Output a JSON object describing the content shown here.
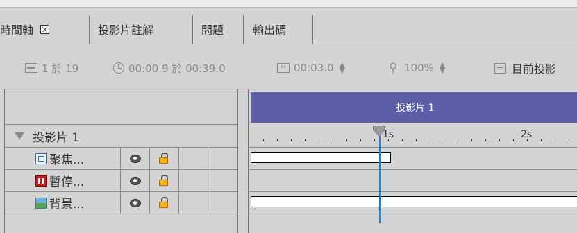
{
  "tabs": [
    {
      "label": "時間軸",
      "active": true
    },
    {
      "label": "投影片註解",
      "active": false
    },
    {
      "label": "問題",
      "active": false
    },
    {
      "label": "輸出碼",
      "active": false
    }
  ],
  "toolbar": {
    "slide_position": "1 於 19",
    "time_position": "00:00.9 於 00:39.0",
    "duration": "00:03.0",
    "zoom": "100%",
    "current_label": "目前投影"
  },
  "layers": {
    "group_name": "投影片 1",
    "items": [
      {
        "name": "聚焦...",
        "icon": "focus-area-icon"
      },
      {
        "name": "暫停...",
        "icon": "pause-icon"
      },
      {
        "name": "背景...",
        "icon": "background-image-icon"
      }
    ]
  },
  "timeline": {
    "slide_header": "投影片 1",
    "ruler_labels": [
      "1s",
      "2s"
    ],
    "playhead_time_s": 0.9,
    "accent_color": "#5b5fa8",
    "playhead_color": "#1e7fd0"
  }
}
